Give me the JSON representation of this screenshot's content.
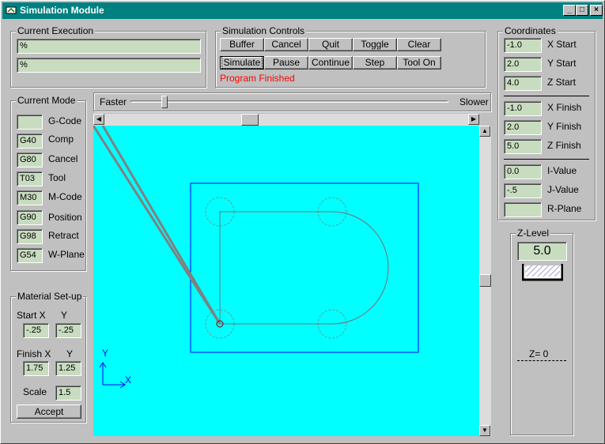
{
  "window": {
    "title": "Simulation Module"
  },
  "current_execution": {
    "label": "Current Execution",
    "line1": "%",
    "line2": "%"
  },
  "sim_controls": {
    "label": "Simulation Controls",
    "row1": [
      "Buffer",
      "Cancel",
      "Quit",
      "Toggle",
      "Clear"
    ],
    "row2": [
      "Simulate",
      "Pause",
      "Continue",
      "Step",
      "Tool On"
    ],
    "status": "Program Finished",
    "status_color": "#ff0000"
  },
  "coordinates": {
    "label": "Coordinates",
    "rows": [
      {
        "value": "-1.0",
        "label": "X Start"
      },
      {
        "value": "2.0",
        "label": "Y Start"
      },
      {
        "value": "4.0",
        "label": "Z Start"
      },
      {
        "value": "-1.0",
        "label": "X Finish"
      },
      {
        "value": "2.0",
        "label": "Y Finish"
      },
      {
        "value": "5.0",
        "label": "Z Finish"
      },
      {
        "value": "0.0",
        "label": "I-Value"
      },
      {
        "value": "-.5",
        "label": "J-Value"
      },
      {
        "value": "",
        "label": "R-Plane"
      }
    ]
  },
  "current_mode": {
    "label": "Current Mode",
    "rows": [
      {
        "value": "",
        "label": "G-Code"
      },
      {
        "value": "G40",
        "label": "Comp"
      },
      {
        "value": "G80",
        "label": "Cancel"
      },
      {
        "value": "T03",
        "label": "Tool"
      },
      {
        "value": "M30",
        "label": "M-Code"
      },
      {
        "value": "G90",
        "label": "Position"
      },
      {
        "value": "G98",
        "label": "Retract"
      },
      {
        "value": "G54",
        "label": "W-Plane"
      }
    ]
  },
  "speed": {
    "faster": "Faster",
    "slower": "Slower",
    "position": 0.1
  },
  "material": {
    "label": "Material Set-up",
    "start_x_label": "Start X",
    "y_label": "Y",
    "start_x": "-.25",
    "start_y": "-.25",
    "finish_x_label": "Finish X",
    "finish_x": "1.75",
    "finish_y": "1.25",
    "scale_label": "Scale",
    "scale": "1.5",
    "accept": "Accept"
  },
  "zlevel": {
    "label": "Z-Level",
    "value": "5.0",
    "marker": "Z= 0"
  },
  "canvas": {
    "background": "#00ffff",
    "axis_x": "X",
    "axis_y": "Y",
    "stock_color": "#0000ff",
    "path_color": "#808080"
  }
}
